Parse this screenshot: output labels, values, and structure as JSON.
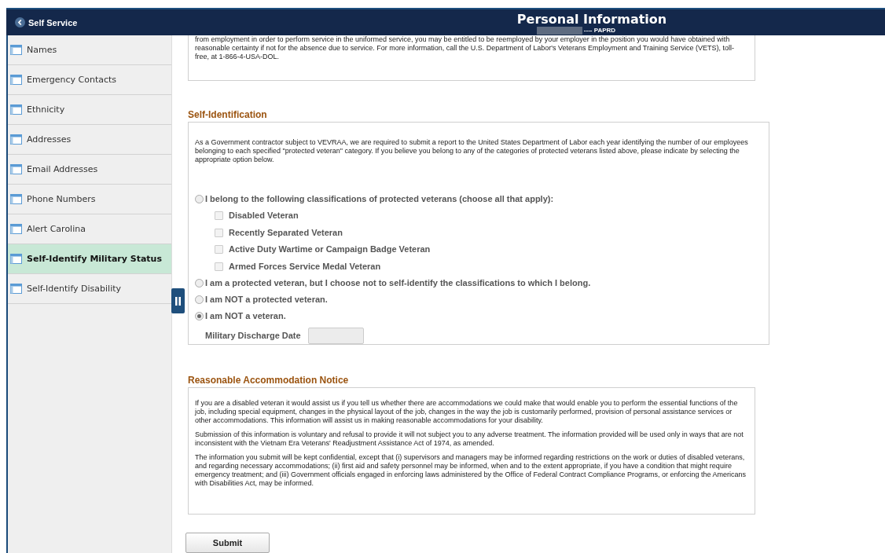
{
  "header": {
    "back_label": "Self Service",
    "title": "Personal Information",
    "subtitle": "---- PAPRD"
  },
  "sidebar": {
    "items": [
      {
        "label": "Names",
        "selected": false
      },
      {
        "label": "Emergency Contacts",
        "selected": false
      },
      {
        "label": "Ethnicity",
        "selected": false
      },
      {
        "label": "Addresses",
        "selected": false
      },
      {
        "label": "Email Addresses",
        "selected": false
      },
      {
        "label": "Phone Numbers",
        "selected": false
      },
      {
        "label": "Alert Carolina",
        "selected": false
      },
      {
        "label": "Self-Identify Military Status",
        "selected": true
      },
      {
        "label": "Self-Identify Disability",
        "selected": false
      }
    ]
  },
  "intro_text": "from employment in order to perform service in the uniformed service, you may be entitled to be reemployed by your employer in the position you would have obtained with reasonable certainty if not for the absence due to service. For more information, call the U.S. Department of Labor's Veterans Employment and Training Service (VETS), toll-free, at 1-866-4-USA-DOL.",
  "self_identification": {
    "heading": "Self-Identification",
    "text": "As a Government contractor subject to VEVRAA, we are required to submit a report to the United States Department of Labor each year identifying the number of our employees belonging to each specified \"protected veteran\" category. If you believe you belong to any of the categories of protected veterans listed above, please indicate by selecting the appropriate option below.",
    "options": [
      {
        "label": "I belong to the following classifications of protected veterans (choose all that apply):",
        "selected": false,
        "checkboxes": [
          {
            "label": "Disabled Veteran",
            "checked": false,
            "disabled": true
          },
          {
            "label": "Recently Separated Veteran",
            "checked": false,
            "disabled": true
          },
          {
            "label": "Active Duty Wartime or Campaign Badge Veteran",
            "checked": false,
            "disabled": true
          },
          {
            "label": "Armed Forces Service Medal Veteran",
            "checked": false,
            "disabled": true
          }
        ]
      },
      {
        "label": "I am a protected veteran, but I choose not to self-identify the classifications to which I belong.",
        "selected": false
      },
      {
        "label": "I am NOT a protected veteran.",
        "selected": false
      },
      {
        "label": "I am NOT a veteran.",
        "selected": true
      }
    ],
    "discharge_date": {
      "label": "Military Discharge Date",
      "disabled": true
    }
  },
  "accommodation": {
    "heading": "Reasonable Accommodation Notice",
    "paragraphs": [
      "If you are a disabled veteran it would assist us if you tell us whether there are accommodations we could make that would enable you to perform the essential functions of the job, including special equipment, changes in the physical layout of the job, changes in the way the job is customarily performed, provision of personal assistance services or other accommodations. This information will assist us in making reasonable accommodations for your disability.",
      "Submission of this information is voluntary and refusal to provide it will not subject you to any adverse treatment. The information provided will be used only in ways that are not inconsistent with the Vietnam Era Veterans' Readjustment Assistance Act of 1974, as amended.",
      "The information you submit will be kept confidential, except that (i) supervisors and managers may be informed regarding restrictions on the work or duties of disabled veterans, and regarding necessary accommodations; (ii) first aid and safety personnel may be informed, when and to the extent appropriate, if you have a condition that might require emergency treatment; and (iii) Government officials engaged in enforcing laws administered by the Office of Federal Contract Compliance Programs, or enforcing the Americans with Disabilities Act, may be informed."
    ]
  },
  "submit_label": "Submit"
}
